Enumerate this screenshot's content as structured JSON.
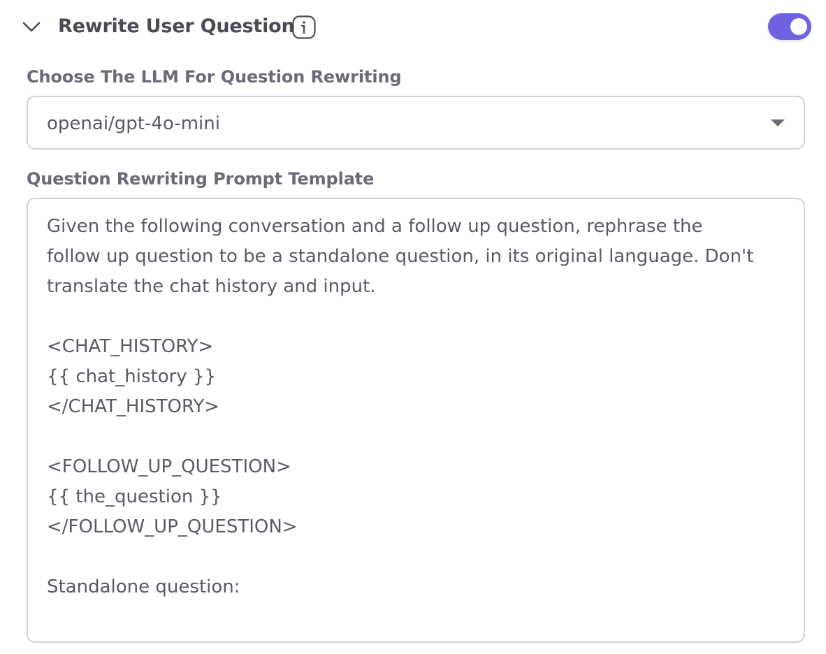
{
  "section": {
    "title": "Rewrite User Question",
    "toggle_on": true,
    "accent_color": "#6f63e0"
  },
  "icons": {
    "collapse": "chevron-down-icon",
    "info": "info-icon"
  },
  "llm_field": {
    "label": "Choose The LLM For Question Rewriting",
    "selected_value": "openai/gpt-4o-mini"
  },
  "prompt_field": {
    "label": "Question Rewriting Prompt Template",
    "value": "Given the following conversation and a follow up question, rephrase the follow up question to be a standalone question, in its original language. Don't translate the chat history and input.\n\n<CHAT_HISTORY>\n{{ chat_history }}\n</CHAT_HISTORY>\n\n<FOLLOW_UP_QUESTION>\n{{ the_question }}\n</FOLLOW_UP_QUESTION>\n\nStandalone question:"
  }
}
